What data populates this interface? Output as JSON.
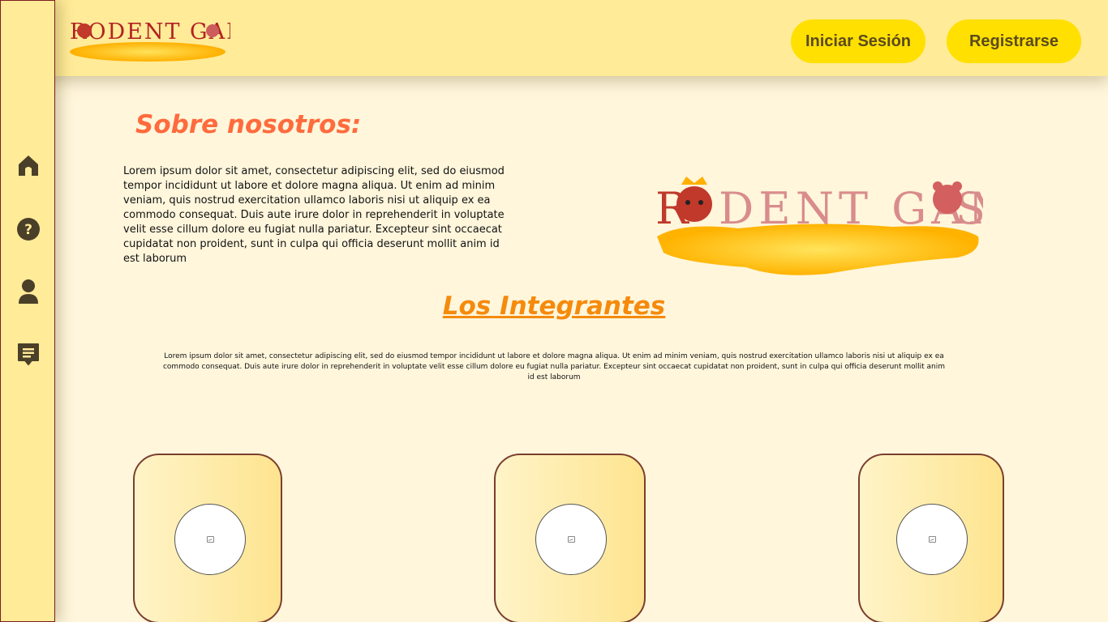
{
  "brand": {
    "logo_text": "RODENT GAMES"
  },
  "header": {
    "login_label": "Iniciar Sesión",
    "register_label": "Registrarse"
  },
  "sidebar": {
    "items": [
      {
        "icon": "home-icon"
      },
      {
        "icon": "help-icon"
      },
      {
        "icon": "user-icon"
      },
      {
        "icon": "chat-icon"
      }
    ]
  },
  "about": {
    "title": "Sobre nosotros:",
    "text": "Lorem ipsum dolor sit amet, consectetur adipiscing elit, sed do eiusmod tempor incididunt ut labore et dolore magna aliqua. Ut enim ad minim veniam, quis nostrud exercitation ullamco laboris nisi ut aliquip ex ea commodo consequat. Duis aute irure dolor in reprehenderit in voluptate velit esse cillum dolore eu fugiat nulla pariatur. Excepteur sint occaecat cupidatat non proident, sunt in culpa qui officia deserunt mollit anim id est laborum"
  },
  "members": {
    "title": "Los Integrantes",
    "text": "Lorem ipsum dolor sit amet, consectetur adipiscing elit, sed do eiusmod tempor incididunt ut labore et dolore magna aliqua. Ut enim ad minim veniam, quis nostrud exercitation ullamco laboris nisi ut aliquip ex ea commodo consequat. Duis aute irure dolor in reprehenderit in voluptate velit esse cillum dolore eu fugiat nulla pariatur. Excepteur sint occaecat cupidatat non proident, sunt in culpa qui officia deserunt mollit anim id est laborum"
  },
  "colors": {
    "accent": "#ff6b3d",
    "subheading": "#f58a0b",
    "button": "#ffe000",
    "topbar": "#ffeb98"
  }
}
